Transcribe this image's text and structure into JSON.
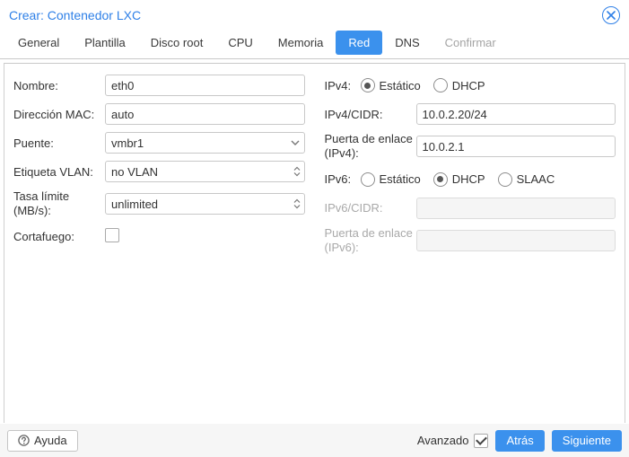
{
  "title": "Crear: Contenedor LXC",
  "tabs": [
    {
      "label": "General"
    },
    {
      "label": "Plantilla"
    },
    {
      "label": "Disco root"
    },
    {
      "label": "CPU"
    },
    {
      "label": "Memoria"
    },
    {
      "label": "Red",
      "active": true
    },
    {
      "label": "DNS"
    },
    {
      "label": "Confirmar",
      "disabled": true
    }
  ],
  "left": {
    "name_label": "Nombre:",
    "name_value": "eth0",
    "mac_label": "Dirección MAC:",
    "mac_value": "auto",
    "bridge_label": "Puente:",
    "bridge_value": "vmbr1",
    "vlan_label": "Etiqueta VLAN:",
    "vlan_value": "no VLAN",
    "rate_label": "Tasa límite (MB/s):",
    "rate_value": "unlimited",
    "firewall_label": "Cortafuego:",
    "firewall_checked": false
  },
  "right": {
    "ipv4_label": "IPv4:",
    "ipv4_static": "Estático",
    "ipv4_dhcp": "DHCP",
    "ipv4_mode": "static",
    "ipv4cidr_label": "IPv4/CIDR:",
    "ipv4cidr_value": "10.0.2.20/24",
    "gw4_label": "Puerta de enlace (IPv4):",
    "gw4_value": "10.0.2.1",
    "ipv6_label": "IPv6:",
    "ipv6_static": "Estático",
    "ipv6_dhcp": "DHCP",
    "ipv6_slaac": "SLAAC",
    "ipv6_mode": "dhcp",
    "ipv6cidr_label": "IPv6/CIDR:",
    "gw6_label": "Puerta de enlace (IPv6):"
  },
  "footer": {
    "help": "Ayuda",
    "advanced": "Avanzado",
    "advanced_checked": true,
    "back": "Atrás",
    "next": "Siguiente"
  }
}
